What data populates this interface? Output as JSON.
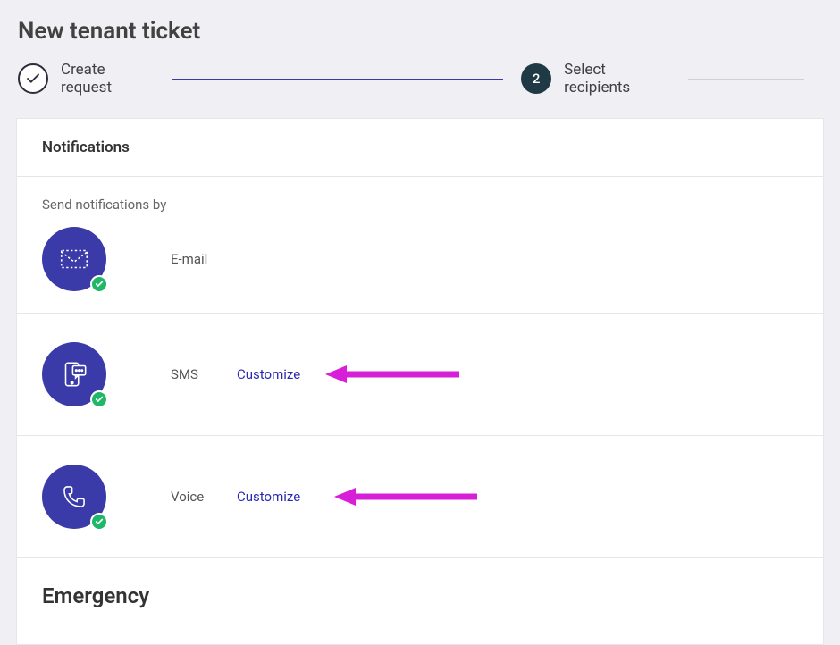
{
  "page": {
    "title": "New tenant ticket"
  },
  "stepper": {
    "step1_label": "Create request",
    "step2_number": "2",
    "step2_label": "Select recipients"
  },
  "notifications": {
    "panel_title": "Notifications",
    "intro": "Send notifications by",
    "items": [
      {
        "label": "E-mail",
        "customize": null
      },
      {
        "label": "SMS",
        "customize": "Customize"
      },
      {
        "label": "Voice",
        "customize": "Customize"
      }
    ]
  },
  "emergency": {
    "title": "Emergency"
  }
}
